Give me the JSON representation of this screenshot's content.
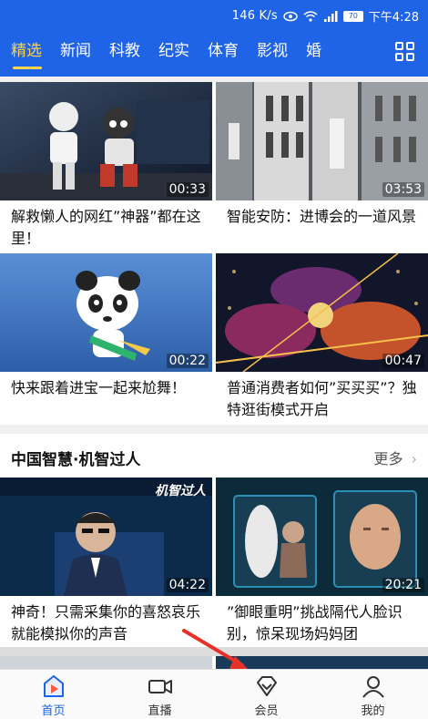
{
  "status_bar": {
    "net_speed": "146 K/s",
    "battery": "70",
    "time": "下午4:28"
  },
  "tabs": [
    {
      "label": "精选",
      "active": true
    },
    {
      "label": "新闻",
      "active": false
    },
    {
      "label": "科教",
      "active": false
    },
    {
      "label": "纪实",
      "active": false
    },
    {
      "label": "体育",
      "active": false
    },
    {
      "label": "影视",
      "active": false
    },
    {
      "label": "婚",
      "active": false
    }
  ],
  "videos": [
    {
      "title": "解救懒人的网红”神器”都在这里！",
      "duration": "00:33"
    },
    {
      "title": "智能安防：进博会的一道风景",
      "duration": "03:53"
    },
    {
      "title": "快来跟着进宝一起来尬舞！",
      "duration": "00:22"
    },
    {
      "title": "普通消费者如何”买买买”？独特逛街模式开启",
      "duration": "00:47"
    }
  ],
  "section": {
    "title": "中国智慧·机智过人",
    "more": "更多",
    "videos": [
      {
        "title": "神奇！只需采集你的喜怒哀乐就能模拟你的声音",
        "duration": "04:22",
        "overlay": "机智过人"
      },
      {
        "title": "”御眼重明”挑战隔代人脸识别，惊呆现场妈妈团",
        "duration": "20:21"
      }
    ]
  },
  "bottom_nav": [
    {
      "label": "首页",
      "active": true
    },
    {
      "label": "直播",
      "active": false
    },
    {
      "label": "会员",
      "active": false
    },
    {
      "label": "我的",
      "active": false
    }
  ],
  "colors": {
    "brand": "#1f63e6",
    "tab_active": "#ffd34a"
  }
}
